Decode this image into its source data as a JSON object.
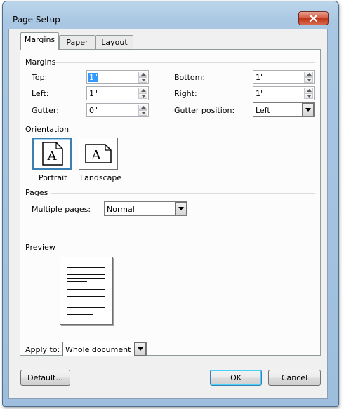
{
  "window": {
    "title": "Page Setup"
  },
  "tabs": [
    {
      "label": "Margins",
      "active": true
    },
    {
      "label": "Paper",
      "active": false
    },
    {
      "label": "Layout",
      "active": false
    }
  ],
  "margins": {
    "section_label": "Margins",
    "top": {
      "label": "Top:",
      "value": "1\""
    },
    "bottom": {
      "label": "Bottom:",
      "value": "1\""
    },
    "left": {
      "label": "Left:",
      "value": "1\""
    },
    "right": {
      "label": "Right:",
      "value": "1\""
    },
    "gutter": {
      "label": "Gutter:",
      "value": "0\""
    },
    "gutter_position": {
      "label": "Gutter position:",
      "value": "Left"
    }
  },
  "orientation": {
    "section_label": "Orientation",
    "icon_letter": "A",
    "portrait_label": "Portrait",
    "landscape_label": "Landscape",
    "selected": "portrait"
  },
  "pages": {
    "section_label": "Pages",
    "multiple_pages_label": "Multiple pages:",
    "multiple_pages_value": "Normal"
  },
  "preview": {
    "section_label": "Preview"
  },
  "apply_to": {
    "label": "Apply to:",
    "value": "Whole document"
  },
  "buttons": {
    "default": "Default...",
    "ok": "OK",
    "cancel": "Cancel"
  },
  "colors": {
    "accent": "#3c7fb1",
    "selection": "#3399ff",
    "close": "#c03418"
  }
}
